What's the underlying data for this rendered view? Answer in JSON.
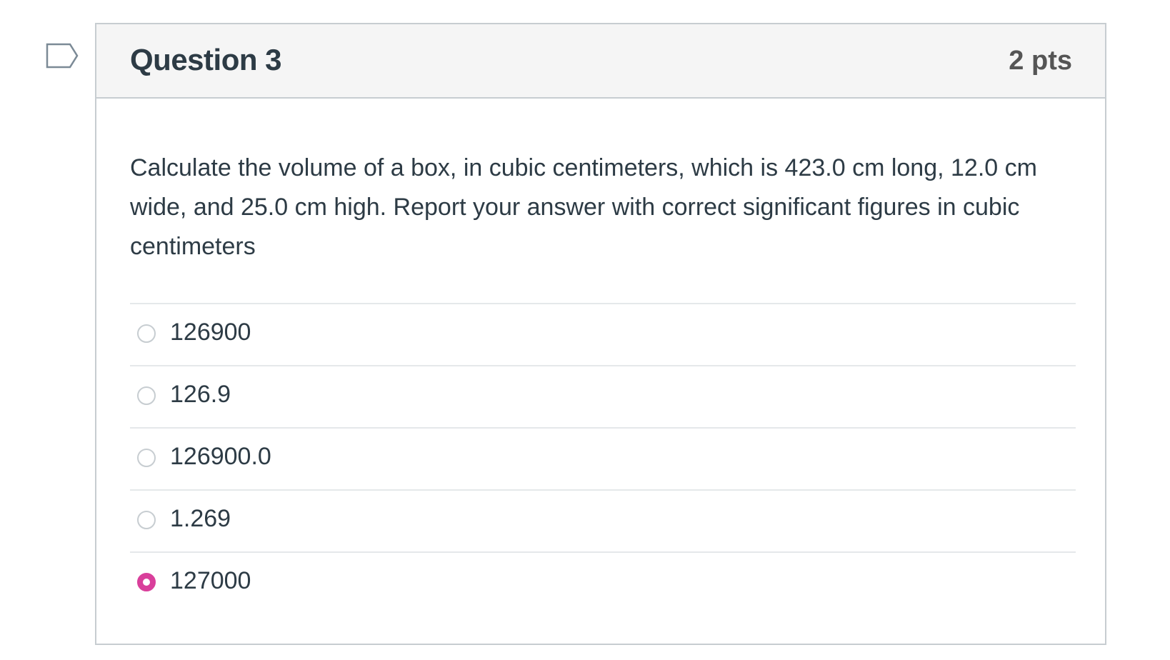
{
  "question": {
    "title": "Question 3",
    "points": "2 pts",
    "text": "Calculate the volume of a box, in cubic centimeters, which is 423.0 cm long, 12.0 cm wide, and 25.0 cm high. Report your answer with correct significant figures in cubic centimeters",
    "flag_icon": "flag-icon",
    "answers": [
      {
        "label": "126900",
        "selected": false
      },
      {
        "label": "126.9",
        "selected": false
      },
      {
        "label": "126900.0",
        "selected": false
      },
      {
        "label": "1.269",
        "selected": false
      },
      {
        "label": "127000",
        "selected": true
      }
    ]
  },
  "colors": {
    "accent": "#d93f9b",
    "header_bg": "#f5f5f5",
    "border": "#c7cdd1",
    "text": "#2d3b45"
  }
}
